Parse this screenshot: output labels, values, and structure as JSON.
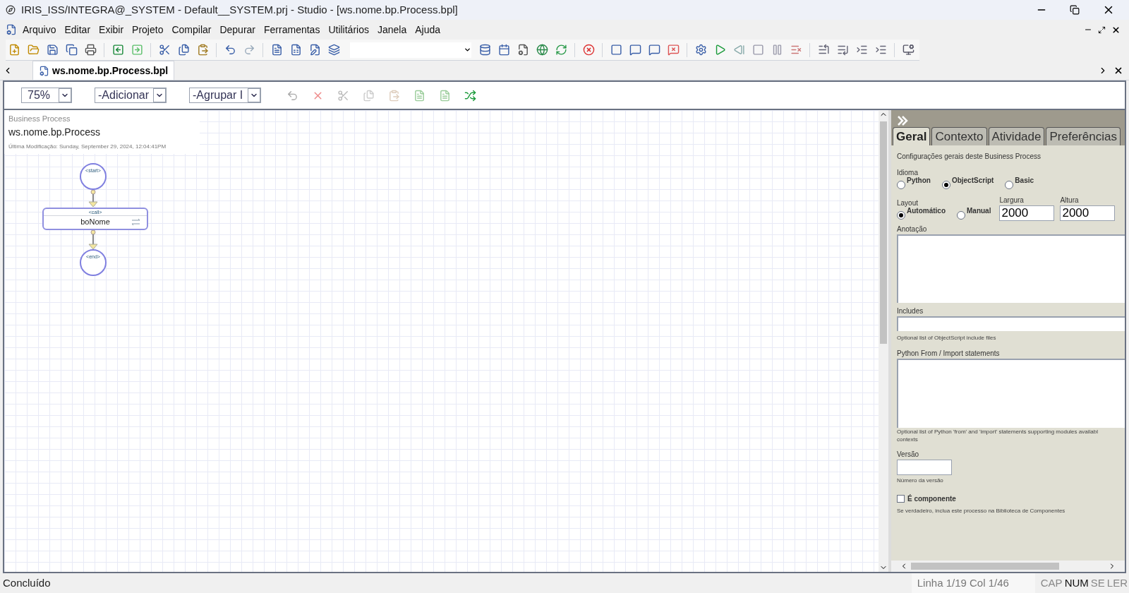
{
  "window": {
    "title": "IRIS_ISS/INTEGRA@_SYSTEM - Default__SYSTEM.prj - Studio - [ws.nome.bp.Process.bpl]"
  },
  "menu": [
    "Arquivo",
    "Editar",
    "Exibir",
    "Projeto",
    "Compilar",
    "Depurar",
    "Ferramentas",
    "Utilitários",
    "Janela",
    "Ajuda"
  ],
  "document_tab": {
    "label": "ws.nome.bp.Process.bpl"
  },
  "editor_toolbar": {
    "zoom": "75%",
    "add": "-Adicionar",
    "group": "-Agrupar I"
  },
  "header": {
    "kind_label": "Business Process",
    "name": "ws.nome.bp.Process",
    "modified": "Última Modificação: Sunday, September 29, 2024, 12:04:41PM"
  },
  "diagram": {
    "start": "<start>",
    "call_tag": "<call>",
    "call_name": "boNome",
    "end": "<end>"
  },
  "panel": {
    "tabs": [
      {
        "label": "Geral",
        "selected": true
      },
      {
        "label": "Contexto",
        "selected": false
      },
      {
        "label": "Atividade",
        "selected": false
      },
      {
        "label": "Preferências",
        "selected": false
      }
    ],
    "description": "Configurações gerais deste Business Process",
    "language": {
      "label": "Idioma",
      "options": [
        {
          "label": "Python",
          "selected": false
        },
        {
          "label": "ObjectScript",
          "selected": true
        },
        {
          "label": "Basic",
          "selected": false
        }
      ]
    },
    "layout": {
      "label": "Layout",
      "options": [
        {
          "label": "Automático",
          "selected": true
        },
        {
          "label": "Manual",
          "selected": false
        }
      ]
    },
    "width": {
      "label": "Largura",
      "value": "2000"
    },
    "height": {
      "label": "Altura",
      "value": "2000"
    },
    "annotation": {
      "label": "Anotação"
    },
    "includes": {
      "label": "Includes",
      "hint": "Optional list of ObjectScript include files"
    },
    "python_imports": {
      "label": "Python From / Import statements",
      "hint_lines": [
        "Optional list of Python 'from' and 'import' statements supporting modules availabl",
        "contexts"
      ]
    },
    "version": {
      "label": "Versão",
      "hint": "Número da versão"
    },
    "component": {
      "label": "É componente",
      "checked": false,
      "hint": "Se verdadeiro, inclua este processo na Biblioteca de Componentes"
    }
  },
  "status_bar": {
    "message": "Concluído",
    "position": "Linha 1/19 Col 1/46",
    "indicators": [
      {
        "label": "CAP",
        "on": false
      },
      {
        "label": "NUM",
        "on": true
      },
      {
        "label": "SE",
        "on": false
      },
      {
        "label": "LER",
        "on": false
      }
    ]
  }
}
